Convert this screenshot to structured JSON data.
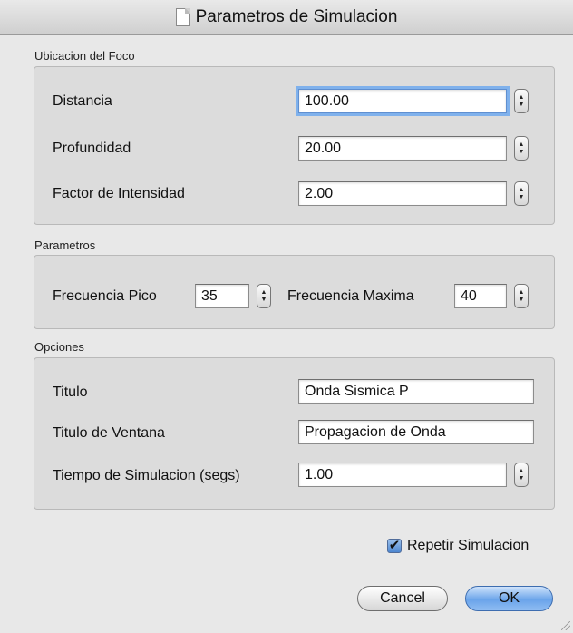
{
  "window": {
    "title": "Parametros de Simulacion"
  },
  "foco": {
    "group_label": "Ubicacion del Foco",
    "distancia": {
      "label": "Distancia",
      "value": "100.00"
    },
    "profundidad": {
      "label": "Profundidad",
      "value": "20.00"
    },
    "factor": {
      "label": "Factor de Intensidad",
      "value": "2.00"
    }
  },
  "parametros": {
    "group_label": "Parametros",
    "frecuencia_pico": {
      "label": "Frecuencia Pico",
      "value": "35"
    },
    "frecuencia_maxima": {
      "label": "Frecuencia Maxima",
      "value": "40"
    }
  },
  "opciones": {
    "group_label": "Opciones",
    "titulo": {
      "label": "Titulo",
      "value": "Onda Sismica P"
    },
    "titulo_ventana": {
      "label": "Titulo de Ventana",
      "value": "Propagacion de Onda"
    },
    "tiempo": {
      "label": "Tiempo de Simulacion (segs)",
      "value": "1.00"
    }
  },
  "repetir": {
    "label": "Repetir Simulacion",
    "checked": true,
    "check_glyph": "✔"
  },
  "buttons": {
    "cancel": "Cancel",
    "ok": "OK"
  },
  "stepper_glyphs": {
    "up": "▲",
    "down": "▼"
  },
  "colors": {
    "focus_ring": "#7fb1ec",
    "ok_button": "#6aa4ea",
    "checkbox": "#4c86d0"
  }
}
